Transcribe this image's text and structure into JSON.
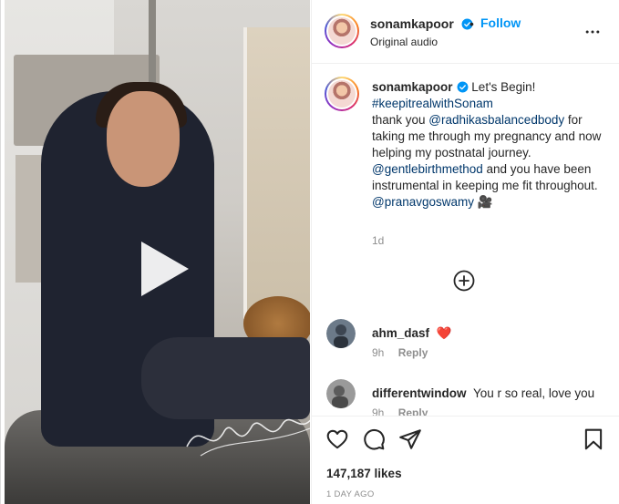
{
  "post": {
    "username": "sonamkapoor",
    "follow_label": "Follow",
    "separator": "•",
    "audio": "Original audio"
  },
  "caption": {
    "username": "sonamkapoor",
    "first_line": "Let's Begin!",
    "hashtag": "#keepitrealwithSonam",
    "text_1": "thank you ",
    "mention_1": "@radhikasbalancedbody",
    "text_2": " for taking me through my pregnancy and now helping my postnatal journey. ",
    "mention_2": "@gentlebirthmethod",
    "text_3": " and you have been instrumental in keeping me fit throughout.",
    "mention_3": "@pranavgoswamy",
    "emoji": "🎥",
    "time": "1d"
  },
  "comments": [
    {
      "username": "ahm_dasf",
      "text": "❤️",
      "time": "9h",
      "reply_label": "Reply"
    },
    {
      "username": "differentwindow",
      "text": "You r so real, love you",
      "time": "9h",
      "reply_label": "Reply"
    }
  ],
  "engagement": {
    "likes": "147,187 likes",
    "posted": "1 DAY AGO"
  },
  "colors": {
    "link_blue": "#0095f6",
    "mention": "#00376b",
    "secondary_text": "#8e8e8e",
    "verified": "#0095f6",
    "heart": "#ed4956"
  },
  "icons": {
    "play": "play-icon",
    "more": "more-options-icon",
    "add_comment": "plus-circle-icon",
    "like": "heart-icon",
    "comment": "comment-icon",
    "share": "share-icon",
    "save": "bookmark-icon",
    "verified": "verified-badge-icon"
  }
}
